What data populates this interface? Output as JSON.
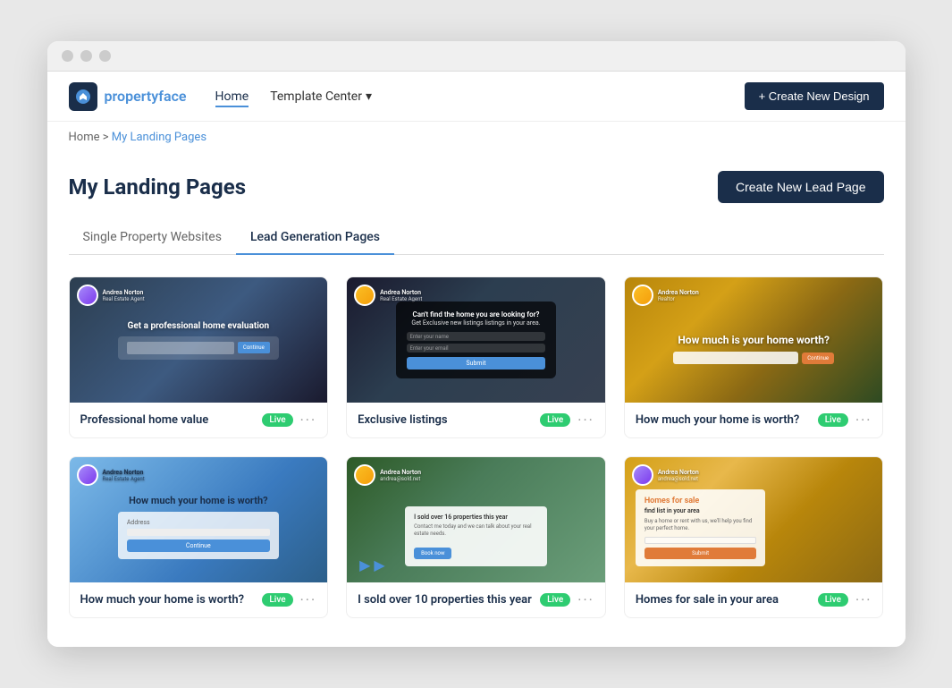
{
  "browser": {
    "dots": [
      "dot1",
      "dot2",
      "dot3"
    ]
  },
  "navbar": {
    "logo_icon": "pf",
    "logo_text_1": "property",
    "logo_text_2": "face",
    "nav_home": "Home",
    "nav_template": "Template Center",
    "btn_create_design": "+ Create New Design"
  },
  "breadcrumb": {
    "home": "Home",
    "separator": ">",
    "current": "My Landing Pages"
  },
  "page": {
    "title": "My Landing Pages",
    "btn_create_lead": "Create New Lead Page"
  },
  "tabs": [
    {
      "id": "single",
      "label": "Single Property Websites",
      "active": false
    },
    {
      "id": "lead",
      "label": "Lead Generation Pages",
      "active": true
    }
  ],
  "cards": [
    {
      "id": "card-1",
      "name": "Professional home value",
      "badge": "Live",
      "thumb_class": "thumb-1",
      "ui_type": "form_dark"
    },
    {
      "id": "card-2",
      "name": "Exclusive listings",
      "badge": "Live",
      "thumb_class": "thumb-2",
      "ui_type": "form_modal"
    },
    {
      "id": "card-3",
      "name": "How much your home is worth?",
      "badge": "Live",
      "thumb_class": "thumb-3",
      "ui_type": "form_light"
    },
    {
      "id": "card-4",
      "name": "How much your home is worth?",
      "badge": "Live",
      "thumb_class": "thumb-4",
      "ui_type": "form_blue"
    },
    {
      "id": "card-5",
      "name": "I sold over 10 properties this year",
      "badge": "Live",
      "thumb_class": "thumb-5",
      "ui_type": "video"
    },
    {
      "id": "card-6",
      "name": "Homes for sale in your area",
      "badge": "Live",
      "thumb_class": "thumb-6",
      "ui_type": "form_orange"
    }
  ]
}
